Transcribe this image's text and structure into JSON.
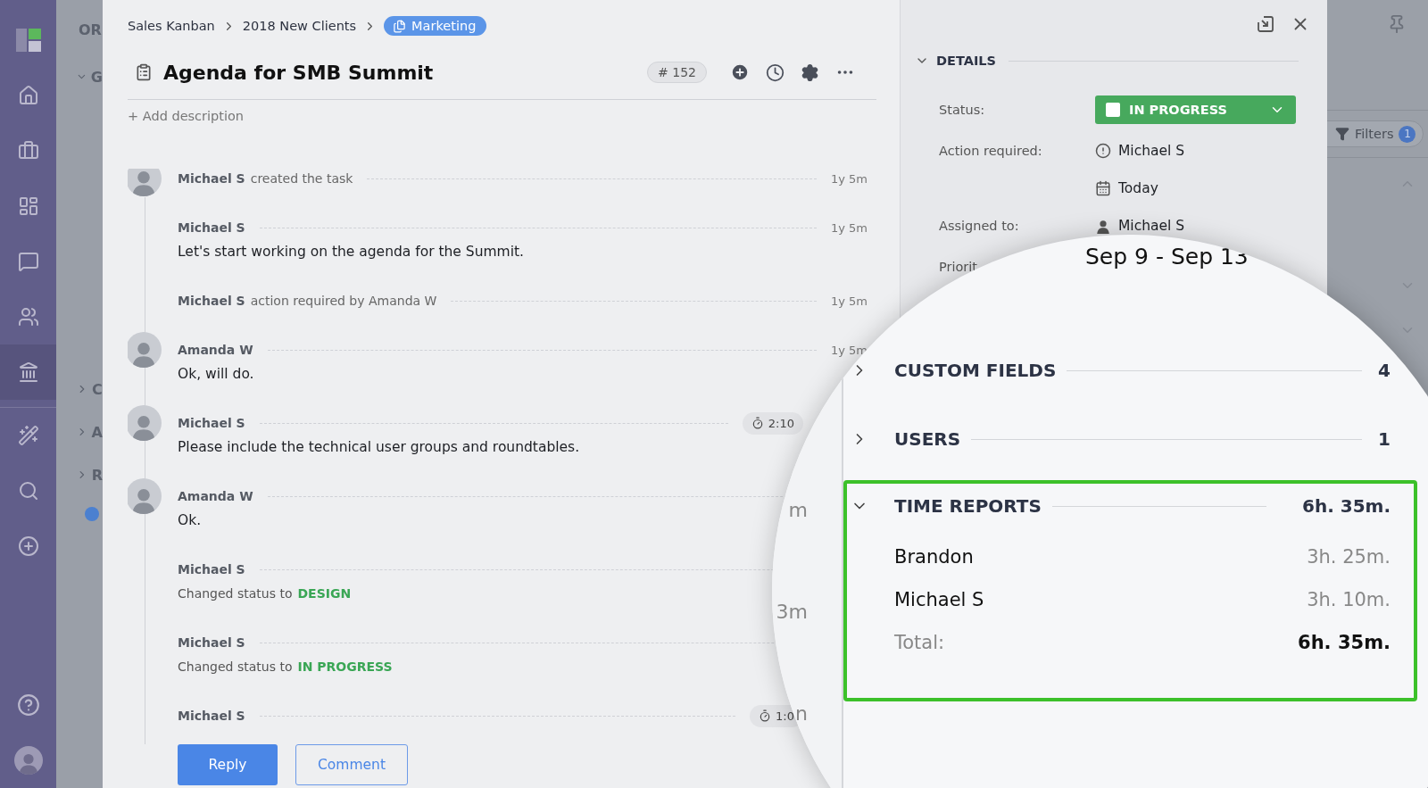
{
  "nav_items": [
    {
      "selected": false
    },
    {
      "selected": false
    },
    {
      "selected": false
    },
    {
      "selected": false
    },
    {
      "selected": false
    },
    {
      "selected": false
    },
    {
      "selected": true
    },
    {
      "selected": false
    },
    {
      "selected": false
    },
    {
      "selected": false
    }
  ],
  "board": {
    "heading": "OR",
    "groups": [
      {
        "label": "G",
        "expanded": true
      },
      {
        "label": "C",
        "expanded": false
      },
      {
        "label": "A",
        "expanded": false
      },
      {
        "label": "R",
        "expanded": false
      }
    ]
  },
  "breadcrumb": [
    "Sales Kanban",
    "2018 New Clients"
  ],
  "current_list": "Marketing",
  "task": {
    "title": "Agenda for SMB Summit",
    "number": "# 152",
    "add_description": "+ Add description"
  },
  "feed": [
    {
      "kind": "event",
      "author": "Michael S",
      "avatar": true,
      "action": "created the task",
      "time": "1y 5m"
    },
    {
      "kind": "comment",
      "author": "Michael S",
      "avatar": false,
      "text": "Let's start working on the agenda for the Summit.",
      "time": "1y 5m"
    },
    {
      "kind": "event",
      "author": "Michael S",
      "avatar": false,
      "action": "action required by Amanda W",
      "time": "1y 5m"
    },
    {
      "kind": "comment",
      "author": "Amanda W",
      "avatar": true,
      "text": "Ok, will do.",
      "time": "1y 5m"
    },
    {
      "kind": "comment",
      "author": "Michael S",
      "avatar": true,
      "text": "Please include the technical user groups and roundtables.",
      "timer": "2:10"
    },
    {
      "kind": "comment",
      "author": "Amanda W",
      "avatar": true,
      "text": "Ok."
    },
    {
      "kind": "status",
      "author": "Michael S",
      "avatar": false,
      "text": "Changed status to",
      "status": "DESIGN"
    },
    {
      "kind": "status",
      "author": "Michael S",
      "avatar": false,
      "text": "Changed status to",
      "status": "IN PROGRESS"
    },
    {
      "kind": "event",
      "author": "Michael S",
      "avatar": false,
      "timer": "1:0"
    }
  ],
  "actions": [
    {
      "label": "Reply",
      "primary": true
    },
    {
      "label": "Comment",
      "primary": false
    }
  ],
  "details": {
    "title": "DETAILS",
    "expanded": true,
    "fields": [
      {
        "kind": "status",
        "label": "Status:",
        "value": "IN PROGRESS"
      },
      {
        "kind": "alert",
        "label": "Action required:",
        "value": "Michael S"
      },
      {
        "kind": "date",
        "value": "Today"
      },
      {
        "kind": "person",
        "label": "Assigned to:",
        "value": "Michael S"
      },
      {
        "kind": "label_only",
        "label": "Priorit"
      }
    ]
  },
  "filters": {
    "label": "Filters",
    "count": "1"
  },
  "magnifier": {
    "date_range": "Sep 9 - Sep 13",
    "feed_fragments": [
      "m",
      "3m",
      "n"
    ],
    "sections": [
      {
        "title": "CUSTOM FIELDS",
        "expanded": false,
        "highlighted": false,
        "count": "4"
      },
      {
        "title": "USERS",
        "expanded": false,
        "highlighted": false,
        "count": "1"
      },
      {
        "title": "TIME REPORTS",
        "expanded": true,
        "highlighted": true,
        "count": "6h. 35m.",
        "rows": [
          {
            "name": "Brandon",
            "time": "3h. 25m."
          },
          {
            "name": "Michael S",
            "time": "3h. 10m."
          }
        ],
        "total": {
          "label": "Total:",
          "time": "6h. 35m."
        }
      }
    ]
  }
}
